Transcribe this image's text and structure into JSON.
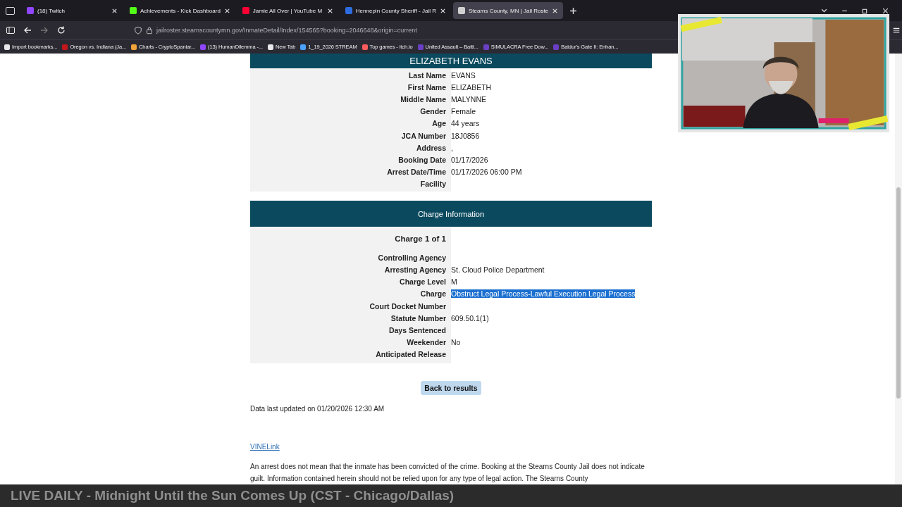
{
  "tabs": [
    {
      "title": "(18) Twitch",
      "selected": false
    },
    {
      "title": "Achievements - Kick Dashboard",
      "selected": false
    },
    {
      "title": "Jamie All Over | YouTube M",
      "selected": false
    },
    {
      "title": "Hennepin County Sheriff - Jail R",
      "selected": false
    },
    {
      "title": "Stearns County, MN | Jail Roste",
      "selected": true
    }
  ],
  "url": "jailroster.stearnscountymn.gov/InmateDetail/Index/154565?booking=2046648&origin=current",
  "bookmarks": [
    {
      "label": "Import bookmarks...",
      "color": "#e8e8e8"
    },
    {
      "label": "Oregon vs. Indiana (Ja...",
      "color": "#c4161c"
    },
    {
      "label": "Charts - CryptoSpaniar...",
      "color": "#f2a33a"
    },
    {
      "label": "(13) HumanDilemma -...",
      "color": "#9146ff"
    },
    {
      "label": "New Tab",
      "color": "#e8e8e8"
    },
    {
      "label": "1_19_2026 STREAM",
      "color": "#4aa3ff"
    },
    {
      "label": "Top games - itch.io",
      "color": "#fa5c5c"
    },
    {
      "label": "United Assault – Battl...",
      "color": "#6b3fc4"
    },
    {
      "label": "SIMULACRA Free Dow...",
      "color": "#6b3fc4"
    },
    {
      "label": "Baldur's Gate II: Enhan...",
      "color": "#6b3fc4"
    }
  ],
  "inmate": {
    "name": "ELIZABETH EVANS",
    "fields": [
      {
        "label": "Last Name",
        "value": "EVANS"
      },
      {
        "label": "First Name",
        "value": "ELIZABETH"
      },
      {
        "label": "Middle Name",
        "value": "MALYNNE"
      },
      {
        "label": "Gender",
        "value": "Female"
      },
      {
        "label": "Age",
        "value": "44 years"
      },
      {
        "label": "JCA Number",
        "value": "18J0856"
      },
      {
        "label": "Address",
        "value": ","
      },
      {
        "label": "Booking Date",
        "value": "01/17/2026"
      },
      {
        "label": "Arrest Date/Time",
        "value": "01/17/2026 06:00 PM"
      },
      {
        "label": "Facility"
      }
    ]
  },
  "charges": {
    "title": "Charge Information",
    "heading": "Charge 1 of 1",
    "fields": [
      {
        "label": "Controlling Agency"
      },
      {
        "label": "Arresting Agency",
        "value": "St. Cloud Police Department"
      },
      {
        "label": "Charge Level",
        "value": "M"
      },
      {
        "label": "Charge",
        "value": "Obstruct Legal Process-Lawful Execution Legal Process",
        "highlighted": true
      },
      {
        "label": "Court Docket Number"
      },
      {
        "label": "Statute Number",
        "value": "609.50.1(1)"
      },
      {
        "label": "Days Sentenced"
      },
      {
        "label": "Weekender",
        "value": "No"
      },
      {
        "label": "Anticipated Release"
      }
    ]
  },
  "back_button": "Back to results",
  "last_updated": "Data last updated on 01/20/2026 12:30 AM",
  "vine_link": "VINELink",
  "disclaimer": "An arrest does not mean that the inmate has been convicted of the crime. Booking at the Stearns County Jail does not indicate guilt. Information contained herein should not be relied upon for any type of legal action. The Stearns County",
  "banner": "LIVE DAILY - Midnight Until the Sun Comes Up (CST - Chicago/Dallas)"
}
